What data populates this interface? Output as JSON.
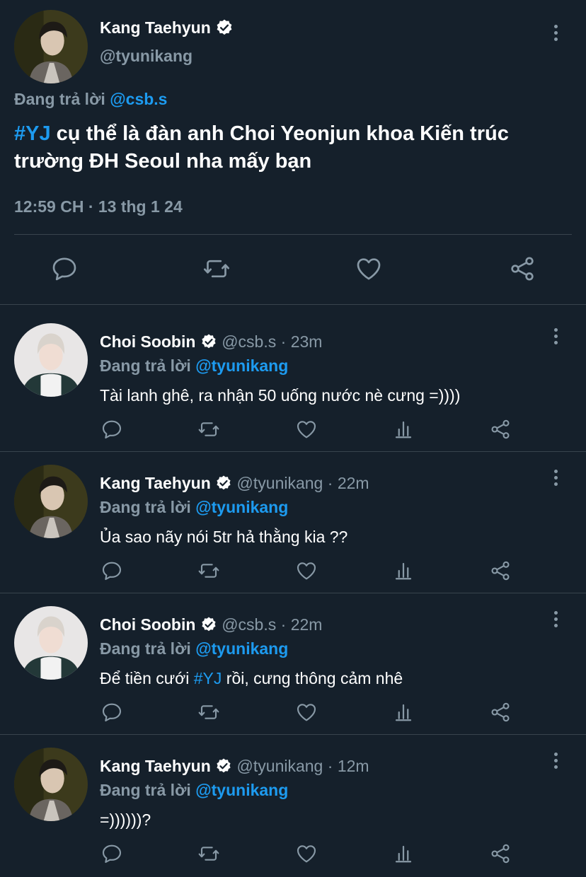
{
  "colors": {
    "background": "#15202b",
    "accent": "#1d9bf0",
    "muted": "#8899a6",
    "divider": "#38444d"
  },
  "main_tweet": {
    "name": "Kang Taehyun",
    "handle": "@tyunikang",
    "replying_prefix": "Đang trả lời",
    "replying_to": "@csb.s",
    "hashtag": "#YJ",
    "text": " cụ thể là đàn anh Choi Yeonjun khoa Kiến trúc trường ĐH Seoul nha mấy bạn",
    "timestamp": "12:59 CH · 13 thg 1 24",
    "actions": [
      "reply-icon",
      "retweet-icon",
      "like-icon",
      "share-icon"
    ]
  },
  "replies": [
    {
      "name": "Choi Soobin",
      "handle": "@csb.s",
      "sep": " · ",
      "time": "23m",
      "replying_prefix": "Đang trả lời",
      "replying_to": "@tyunikang",
      "text_before": "Tài lanh ghê, ra nhận 50 uống nước nè cưng =))))",
      "hashtag": "",
      "text_after": ""
    },
    {
      "name": "Kang Taehyun",
      "handle": "@tyunikang",
      "sep": " · ",
      "time": "22m",
      "replying_prefix": "Đang trả lời",
      "replying_to": "@tyunikang",
      "text_before": "Ủa sao nãy nói 5tr hả thằng kia ??",
      "hashtag": "",
      "text_after": ""
    },
    {
      "name": "Choi Soobin",
      "handle": "@csb.s",
      "sep": " · ",
      "time": "22m",
      "replying_prefix": "Đang trả lời",
      "replying_to": "@tyunikang",
      "text_before": "Để tiền cưới ",
      "hashtag": "#YJ",
      "text_after": " rồi, cưng thông cảm nhê"
    },
    {
      "name": "Kang Taehyun",
      "handle": "@tyunikang",
      "sep": " · ",
      "time": "12m",
      "replying_prefix": "Đang trả lời",
      "replying_to": "@tyunikang",
      "text_before": "=))))))?",
      "hashtag": "",
      "text_after": ""
    }
  ],
  "reply_actions": [
    "reply-icon",
    "retweet-icon",
    "like-icon",
    "analytics-icon",
    "share-icon"
  ]
}
